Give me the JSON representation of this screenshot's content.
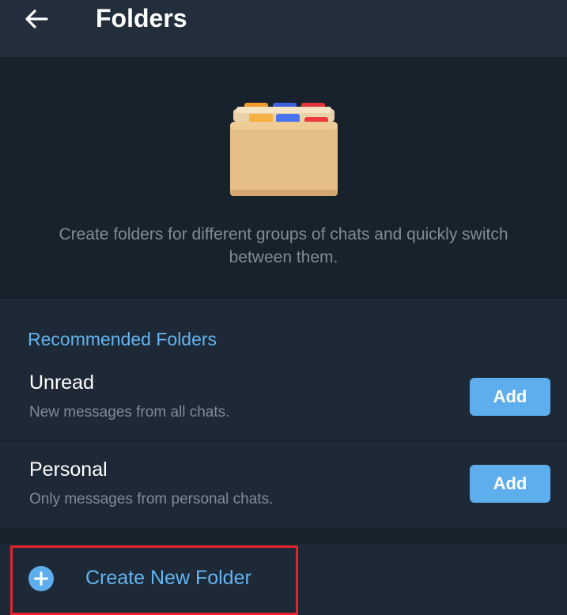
{
  "header": {
    "title": "Folders",
    "back_icon": "arrow-left-icon"
  },
  "hero": {
    "illustration": "folder-cabinet-icon",
    "description": "Create folders for different groups of chats and quickly switch between them."
  },
  "recommended": {
    "heading": "Recommended Folders",
    "items": [
      {
        "name": "Unread",
        "description": "New messages from all chats.",
        "button_label": "Add"
      },
      {
        "name": "Personal",
        "description": "Only messages from personal chats.",
        "button_label": "Add"
      }
    ]
  },
  "create": {
    "label": "Create New Folder",
    "icon": "plus-circle-icon"
  },
  "colors": {
    "background": "#18222d",
    "header": "#232e3c",
    "section": "#1e2937",
    "accent": "#63b4f0",
    "button": "#5eaeed",
    "secondary_text": "#7f8b96",
    "highlight": "#e3242b"
  }
}
